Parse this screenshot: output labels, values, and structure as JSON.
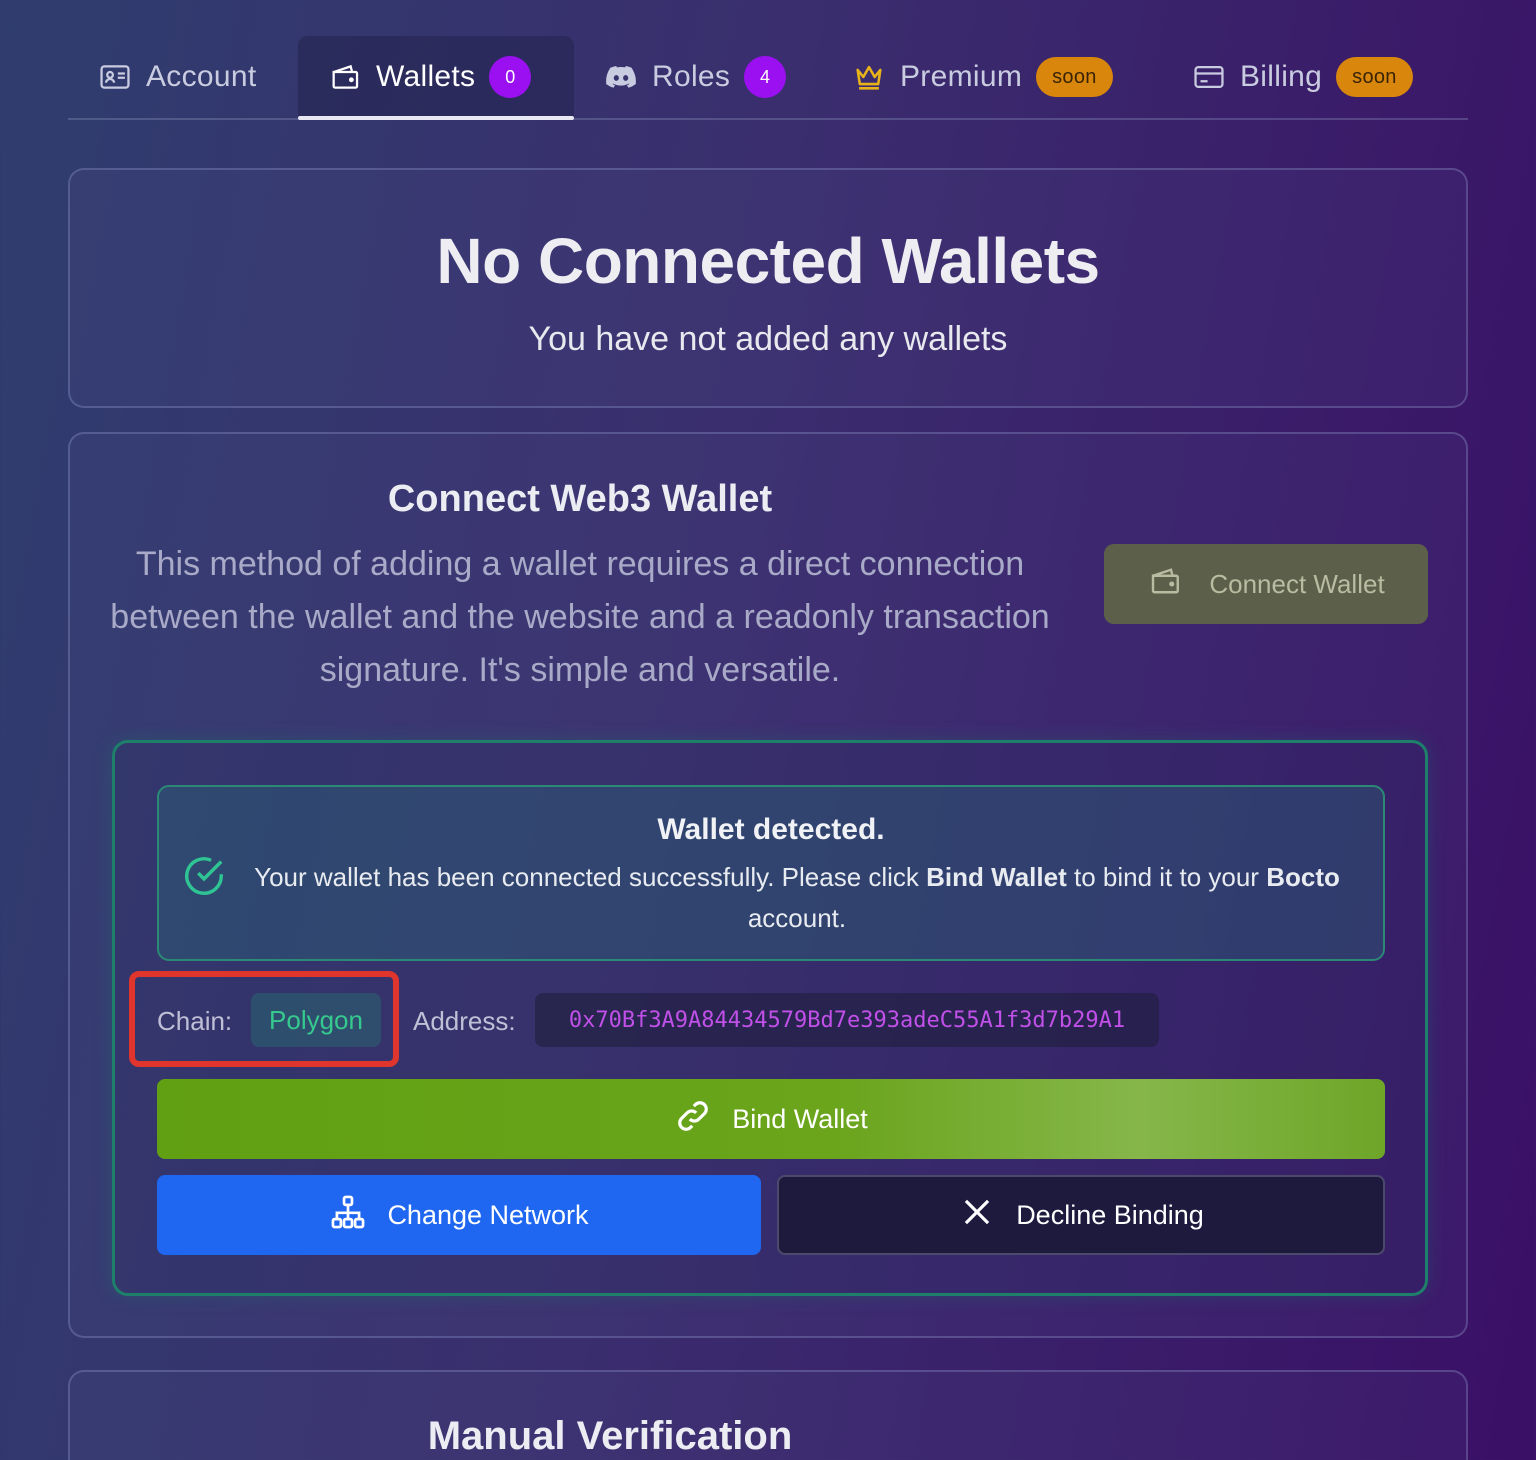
{
  "tabs": [
    {
      "label": "Account",
      "icon": "id-card-icon"
    },
    {
      "label": "Wallets",
      "icon": "wallet-icon",
      "count": "0",
      "active": true
    },
    {
      "label": "Roles",
      "icon": "discord-icon",
      "count": "4"
    },
    {
      "label": "Premium",
      "icon": "crown-icon",
      "badge": "soon"
    },
    {
      "label": "Billing",
      "icon": "credit-card-icon",
      "badge": "soon"
    }
  ],
  "empty_state": {
    "title": "No Connected Wallets",
    "subtitle": "You have not added any wallets"
  },
  "web3": {
    "title": "Connect Web3 Wallet",
    "description": "This method of adding a wallet requires a direct connection between the wallet and the website and a readonly transaction signature. It's simple and versatile.",
    "connect_label": "Connect Wallet",
    "alert": {
      "title": "Wallet detected.",
      "text_1": "Your wallet has been connected successfully. Please click ",
      "bold_1": "Bind Wallet",
      "text_2": " to bind it to your ",
      "bold_2": "Bocto",
      "text_3": " account."
    },
    "chain_label": "Chain:",
    "chain_value": "Polygon",
    "address_label": "Address:",
    "address_value": "0x70Bf3A9A84434579Bd7e393adeC55A1f3d7b29A1",
    "bind_label": "Bind Wallet",
    "change_label": "Change Network",
    "decline_label": "Decline Binding"
  },
  "manual": {
    "title": "Manual Verification"
  },
  "colors": {
    "accent_purple": "#9b10f0",
    "soon_badge": "#d9870c",
    "chain_green": "#36c98e",
    "address_magenta": "#c050e8",
    "bind_green": "#61a012",
    "change_blue": "#1f66f0",
    "highlight_red": "#e0352d"
  }
}
